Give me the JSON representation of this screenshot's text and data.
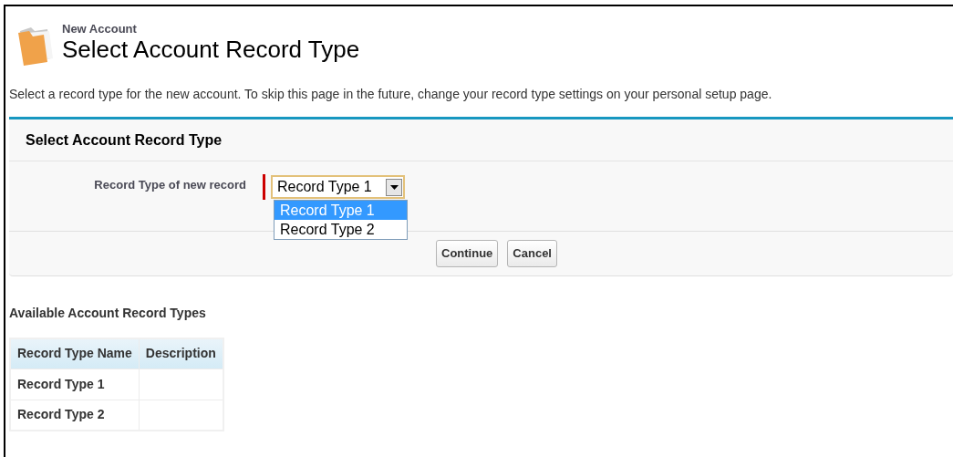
{
  "header": {
    "subtitle": "New Account",
    "title": "Select Account Record Type"
  },
  "instructions": "Select a record type for the new account. To skip this page in the future, change your record type settings on your personal setup page.",
  "panel": {
    "title": "Select Account Record Type",
    "field_label": "Record Type of new record",
    "required": true,
    "dropdown": {
      "value": "Record Type 1",
      "expanded": true,
      "options": [
        {
          "label": "Record Type 1",
          "selected": true
        },
        {
          "label": "Record Type 2",
          "selected": false
        }
      ]
    },
    "buttons": [
      "Continue",
      "Cancel"
    ]
  },
  "available": {
    "title": "Available Account Record Types",
    "columns": [
      "Record Type Name",
      "Description"
    ],
    "rows": [
      {
        "name": "Record Type 1"
      },
      {
        "name": "Record Type 2"
      }
    ]
  }
}
